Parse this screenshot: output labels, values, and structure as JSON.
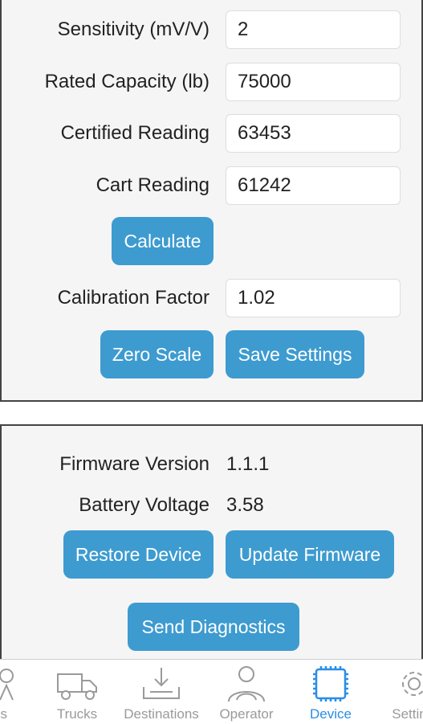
{
  "calibration": {
    "fields": [
      {
        "label": "Sensitivity (mV/V)",
        "value": "2"
      },
      {
        "label": "Rated Capacity (lb)",
        "value": "75000"
      },
      {
        "label": "Certified Reading",
        "value": "63453"
      },
      {
        "label": "Cart Reading",
        "value": "61242"
      }
    ],
    "calculate_label": "Calculate",
    "factor_label": "Calibration Factor",
    "factor_value": "1.02",
    "zero_scale_label": "Zero Scale",
    "save_settings_label": "Save Settings"
  },
  "device_info": {
    "firmware_label": "Firmware Version",
    "firmware_value": "1.1.1",
    "battery_label": "Battery Voltage",
    "battery_value": "3.58",
    "restore_label": "Restore Device",
    "update_label": "Update Firmware",
    "diagnostics_label": "Send Diagnostics"
  },
  "tabbar": {
    "items": [
      {
        "label": "ds",
        "icon": "partial-icon",
        "active": false
      },
      {
        "label": "Trucks",
        "icon": "truck-icon",
        "active": false
      },
      {
        "label": "Destinations",
        "icon": "download-tray-icon",
        "active": false
      },
      {
        "label": "Operator",
        "icon": "operator-icon",
        "active": false
      },
      {
        "label": "Device",
        "icon": "chip-icon",
        "active": true
      },
      {
        "label": "Settin",
        "icon": "gear-icon",
        "active": false
      }
    ]
  },
  "colors": {
    "button": "#3d9bd0",
    "active_tab": "#2a8ee6",
    "inactive_tab": "#9a9a9a"
  }
}
